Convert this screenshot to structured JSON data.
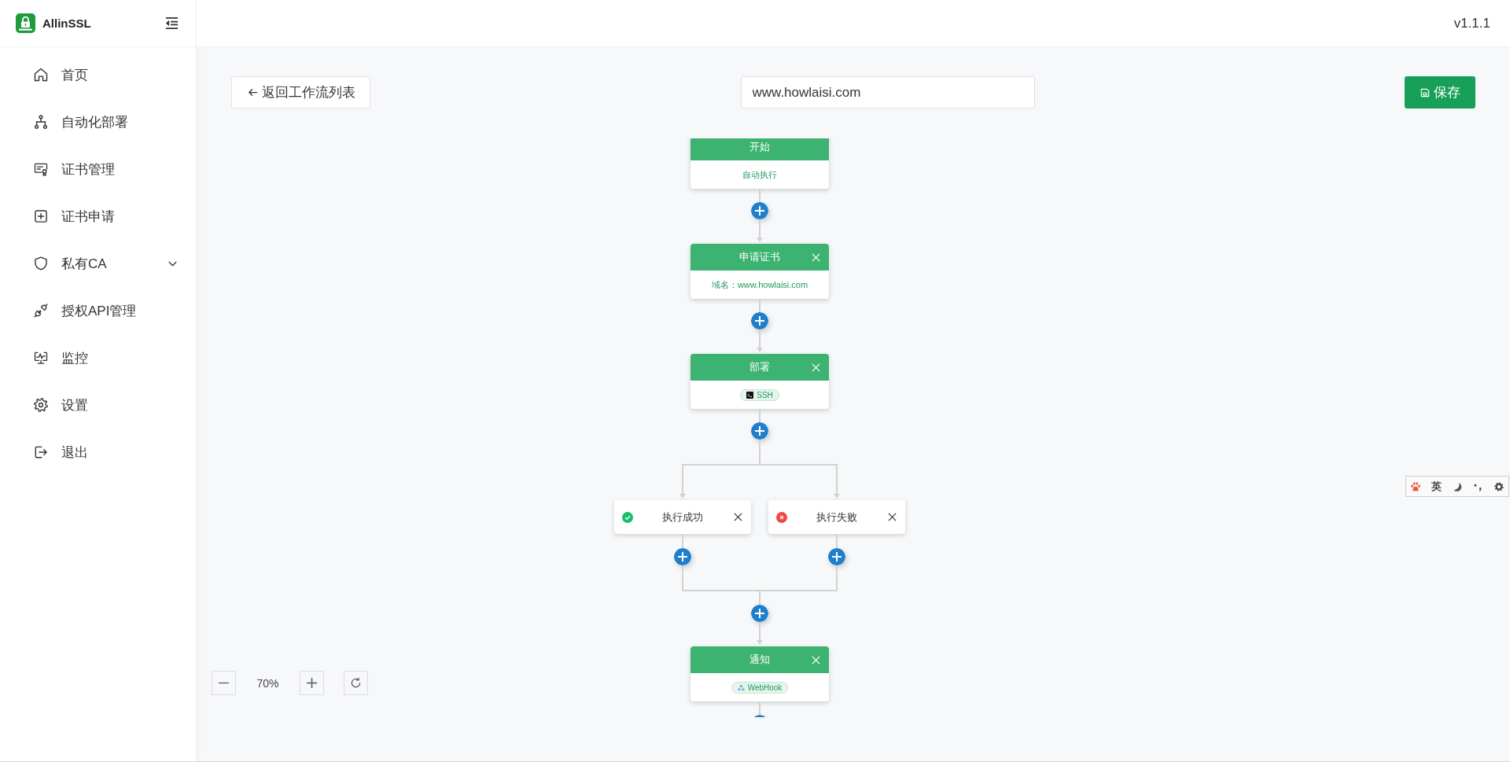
{
  "app": {
    "name": "AllinSSL"
  },
  "sidebar": {
    "items": [
      {
        "label": "首页",
        "kind": "link"
      },
      {
        "label": "自动化部署",
        "kind": "link"
      },
      {
        "label": "证书管理",
        "kind": "link"
      },
      {
        "label": "证书申请",
        "kind": "link"
      },
      {
        "label": "私有CA",
        "kind": "submenu",
        "expanded": false
      },
      {
        "label": "授权API管理",
        "kind": "link"
      },
      {
        "label": "监控",
        "kind": "link"
      },
      {
        "label": "设置",
        "kind": "link"
      },
      {
        "label": "退出",
        "kind": "link"
      }
    ]
  },
  "header": {
    "version": "v1.1.1"
  },
  "toolbar": {
    "back_button": "返回工作流列表",
    "name_field": {
      "value": "www.howlaisi.com"
    },
    "save_button": "保存"
  },
  "flow": {
    "nodes": [
      {
        "kind": "start",
        "title": "开始",
        "detail": "自动执行"
      },
      {
        "kind": "task",
        "title": "申请证书",
        "detail": "域名：www.howlaisi.com"
      },
      {
        "kind": "task",
        "title": "部署",
        "tag": {
          "kind": "ssh",
          "label": "SSH"
        }
      },
      {
        "kind": "branch",
        "branches": [
          {
            "kind": "success",
            "label": "执行成功"
          },
          {
            "kind": "failure",
            "label": "执行失败"
          }
        ]
      },
      {
        "kind": "task",
        "title": "通知",
        "tag": {
          "kind": "webhook",
          "label": "WebHook"
        }
      }
    ]
  },
  "zoom_controls": {
    "value": "70%"
  },
  "ime_toolbar": {
    "mode": "英"
  }
}
